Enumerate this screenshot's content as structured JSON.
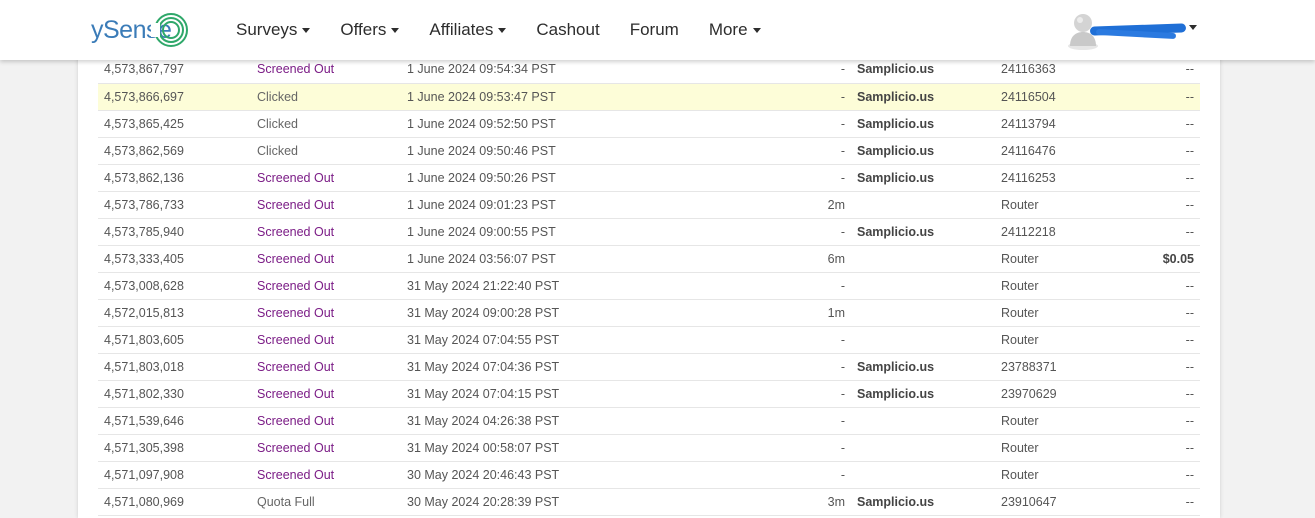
{
  "header": {
    "logo": "ySense",
    "nav": [
      {
        "label": "Surveys",
        "dropdown": true
      },
      {
        "label": "Offers",
        "dropdown": true
      },
      {
        "label": "Affiliates",
        "dropdown": true
      },
      {
        "label": "Cashout",
        "dropdown": false
      },
      {
        "label": "Forum",
        "dropdown": false
      },
      {
        "label": "More",
        "dropdown": true
      }
    ]
  },
  "colors": {
    "brand": "#3b7cb8",
    "screened_out": "#7b1c86",
    "highlight_row": "#fdfdd8"
  },
  "rows": [
    {
      "id": "4,573,867,797",
      "status": "Screened Out",
      "date": "1 June 2024 09:54:34 PST",
      "duration": "-",
      "provider": "Samplicio.us",
      "project": "24116363",
      "reward": "--"
    },
    {
      "id": "4,573,866,697",
      "status": "Clicked",
      "date": "1 June 2024 09:53:47 PST",
      "duration": "-",
      "provider": "Samplicio.us",
      "project": "24116504",
      "reward": "--",
      "highlight": true
    },
    {
      "id": "4,573,865,425",
      "status": "Clicked",
      "date": "1 June 2024 09:52:50 PST",
      "duration": "-",
      "provider": "Samplicio.us",
      "project": "24113794",
      "reward": "--"
    },
    {
      "id": "4,573,862,569",
      "status": "Clicked",
      "date": "1 June 2024 09:50:46 PST",
      "duration": "-",
      "provider": "Samplicio.us",
      "project": "24116476",
      "reward": "--"
    },
    {
      "id": "4,573,862,136",
      "status": "Screened Out",
      "date": "1 June 2024 09:50:26 PST",
      "duration": "-",
      "provider": "Samplicio.us",
      "project": "24116253",
      "reward": "--"
    },
    {
      "id": "4,573,786,733",
      "status": "Screened Out",
      "date": "1 June 2024 09:01:23 PST",
      "duration": "2m",
      "provider": "",
      "project": "Router",
      "reward": "--"
    },
    {
      "id": "4,573,785,940",
      "status": "Screened Out",
      "date": "1 June 2024 09:00:55 PST",
      "duration": "-",
      "provider": "Samplicio.us",
      "project": "24112218",
      "reward": "--"
    },
    {
      "id": "4,573,333,405",
      "status": "Screened Out",
      "date": "1 June 2024 03:56:07 PST",
      "duration": "6m",
      "provider": "",
      "project": "Router",
      "reward": "$0.05"
    },
    {
      "id": "4,573,008,628",
      "status": "Screened Out",
      "date": "31 May 2024 21:22:40 PST",
      "duration": "-",
      "provider": "",
      "project": "Router",
      "reward": "--"
    },
    {
      "id": "4,572,015,813",
      "status": "Screened Out",
      "date": "31 May 2024 09:00:28 PST",
      "duration": "1m",
      "provider": "",
      "project": "Router",
      "reward": "--"
    },
    {
      "id": "4,571,803,605",
      "status": "Screened Out",
      "date": "31 May 2024 07:04:55 PST",
      "duration": "-",
      "provider": "",
      "project": "Router",
      "reward": "--"
    },
    {
      "id": "4,571,803,018",
      "status": "Screened Out",
      "date": "31 May 2024 07:04:36 PST",
      "duration": "-",
      "provider": "Samplicio.us",
      "project": "23788371",
      "reward": "--"
    },
    {
      "id": "4,571,802,330",
      "status": "Screened Out",
      "date": "31 May 2024 07:04:15 PST",
      "duration": "-",
      "provider": "Samplicio.us",
      "project": "23970629",
      "reward": "--"
    },
    {
      "id": "4,571,539,646",
      "status": "Screened Out",
      "date": "31 May 2024 04:26:38 PST",
      "duration": "-",
      "provider": "",
      "project": "Router",
      "reward": "--"
    },
    {
      "id": "4,571,305,398",
      "status": "Screened Out",
      "date": "31 May 2024 00:58:07 PST",
      "duration": "-",
      "provider": "",
      "project": "Router",
      "reward": "--"
    },
    {
      "id": "4,571,097,908",
      "status": "Screened Out",
      "date": "30 May 2024 20:46:43 PST",
      "duration": "-",
      "provider": "",
      "project": "Router",
      "reward": "--"
    },
    {
      "id": "4,571,080,969",
      "status": "Quota Full",
      "date": "30 May 2024 20:28:39 PST",
      "duration": "3m",
      "provider": "Samplicio.us",
      "project": "23910647",
      "reward": "--"
    }
  ]
}
